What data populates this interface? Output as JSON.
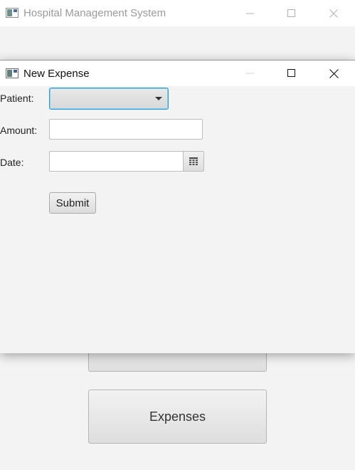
{
  "main_window": {
    "title": "Hospital Management System",
    "buttons": {
      "partial_label": "",
      "expenses_label": "Expenses"
    }
  },
  "dialog": {
    "title": "New Expense",
    "form": {
      "patient_label": "Patient:",
      "patient_value": "",
      "amount_label": "Amount:",
      "amount_value": "",
      "date_label": "Date:",
      "date_value": "",
      "submit_label": "Submit"
    }
  },
  "icons": {
    "app": "app-window-icon",
    "minimize": "minimize-icon",
    "maximize": "maximize-icon",
    "close": "close-icon",
    "dropdown": "chevron-down-icon",
    "calendar": "calendar-icon"
  },
  "colors": {
    "focus_border": "#2a9bd8",
    "background": "#f3f3f3",
    "titlebar": "#ffffff"
  }
}
